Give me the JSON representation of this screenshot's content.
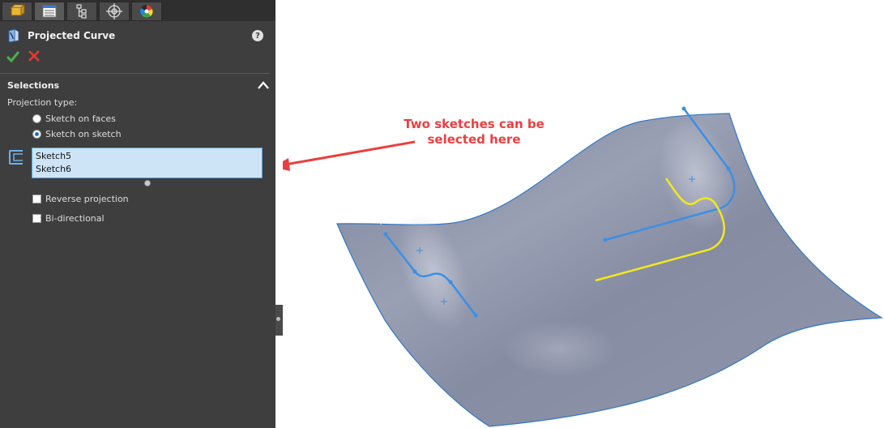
{
  "panel": {
    "title": "Projected Curve",
    "help": "?",
    "sections": {
      "selections": {
        "header": "Selections",
        "projection_type_label": "Projection type:",
        "options": [
          {
            "label": "Sketch on faces",
            "checked": false
          },
          {
            "label": "Sketch on sketch",
            "checked": true
          }
        ],
        "selected_items": [
          "Sketch5",
          "Sketch6"
        ],
        "checkboxes": [
          {
            "label": "Reverse projection",
            "checked": false
          },
          {
            "label": "Bi-directional",
            "checked": false
          }
        ]
      }
    },
    "tabs": [
      {
        "icon": "feature-manager-icon"
      },
      {
        "icon": "property-manager-icon",
        "active": true
      },
      {
        "icon": "configuration-manager-icon"
      },
      {
        "icon": "dimxpert-manager-icon"
      },
      {
        "icon": "display-manager-icon"
      }
    ]
  },
  "annotation": {
    "line1": "Two sketches can be",
    "line2": "selected here",
    "color": "#e84040"
  },
  "colors": {
    "panel_bg": "#3e3e3e",
    "surface": "#8e95a8",
    "sketch_blue": "#3b8fe6",
    "sketch_yellow": "#f2e81e",
    "selection_box": "#cde4f7"
  }
}
